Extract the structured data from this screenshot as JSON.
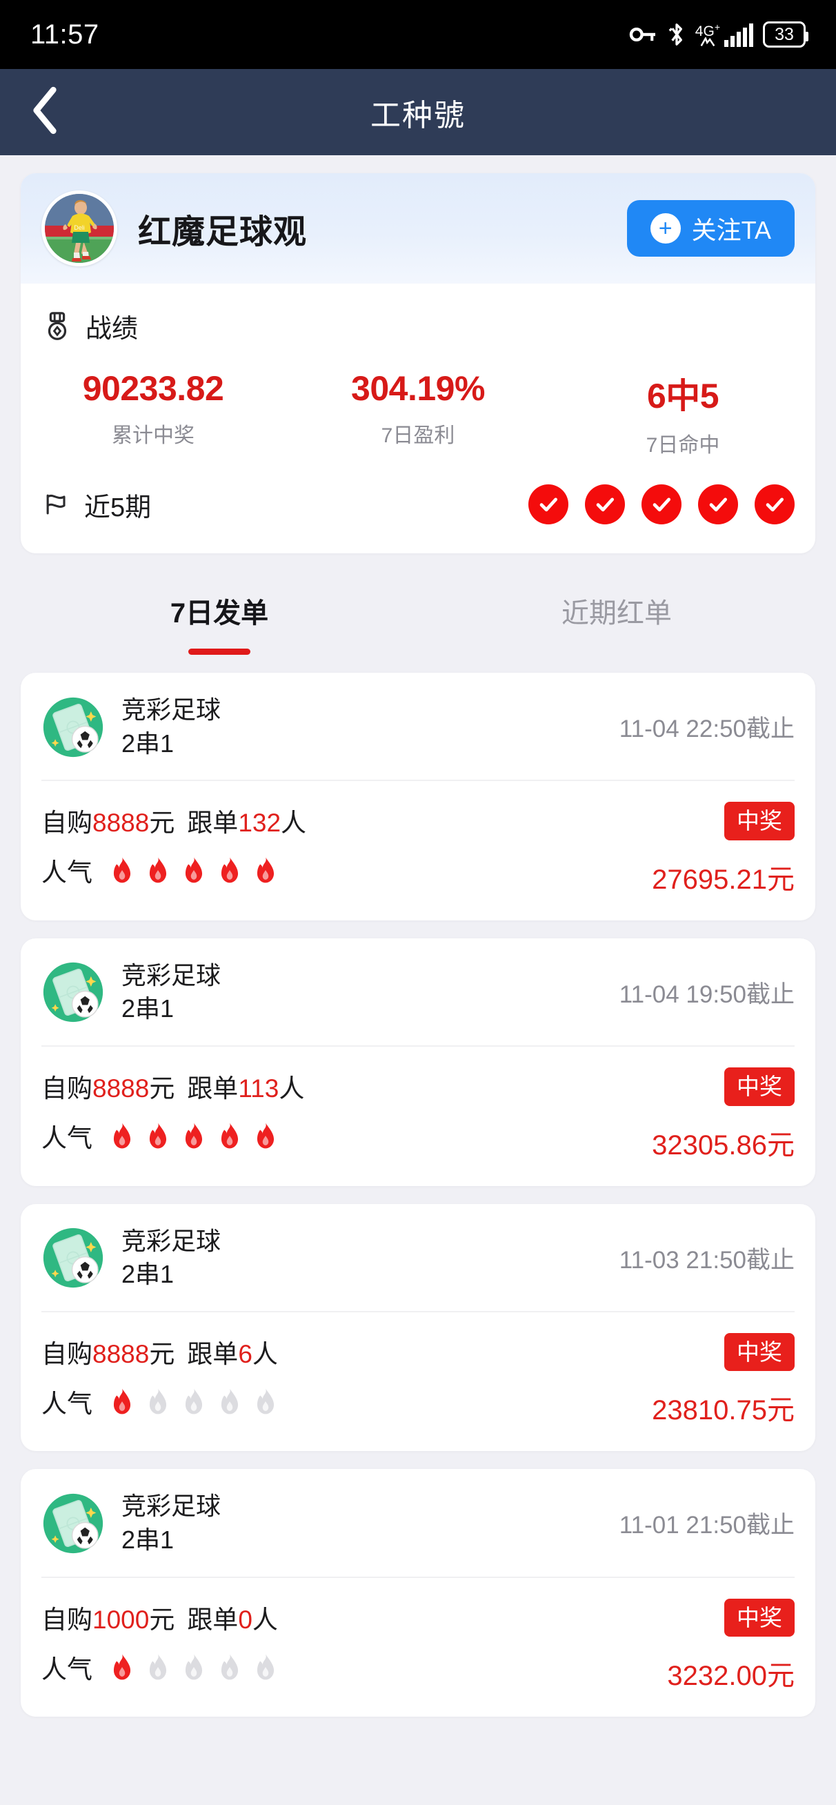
{
  "status_bar": {
    "time": "11:57",
    "battery_level": "33",
    "network_label": "4G",
    "network_plus": "+",
    "icons": [
      "vpn-key-icon",
      "bluetooth-icon",
      "signal-icon",
      "battery-icon"
    ]
  },
  "nav": {
    "title": "工种號",
    "back_icon": "chevron-left-icon"
  },
  "profile": {
    "username": "红魔足球观",
    "avatar_icon": "soccer-player-avatar",
    "follow_button": {
      "label": "关注TA",
      "plus_icon": "plus-icon",
      "color": "#2088f5"
    },
    "record": {
      "icon": "medal-icon",
      "label": "战绩",
      "stats": [
        {
          "value": "90233.82",
          "caption": "累计中奖"
        },
        {
          "value": "304.19%",
          "caption": "7日盈利"
        },
        {
          "value": "6中5",
          "caption": "7日命中"
        }
      ]
    },
    "recent": {
      "icon": "flag-icon",
      "label": "近5期",
      "results": [
        "win",
        "win",
        "win",
        "win",
        "win"
      ],
      "win_icon": "check-circle-icon",
      "win_color": "#f40c0c"
    }
  },
  "tabs": [
    {
      "label": "7日发单",
      "active": true
    },
    {
      "label": "近期红单",
      "active": false
    }
  ],
  "bets": [
    {
      "icon": "soccer-lottery-icon",
      "game": "竞彩足球",
      "combo": "2串1",
      "deadline": "11-04 22:50截止",
      "self_buy_prefix": "自购",
      "self_buy_amount": "8888",
      "self_buy_unit": "元",
      "follow_prefix": "跟单",
      "follow_count": "132",
      "follow_unit": "人",
      "popularity_label": "人气",
      "popularity": 5,
      "status_badge": "中奖",
      "prize": "27695.21元"
    },
    {
      "icon": "soccer-lottery-icon",
      "game": "竞彩足球",
      "combo": "2串1",
      "deadline": "11-04 19:50截止",
      "self_buy_prefix": "自购",
      "self_buy_amount": "8888",
      "self_buy_unit": "元",
      "follow_prefix": "跟单",
      "follow_count": "113",
      "follow_unit": "人",
      "popularity_label": "人气",
      "popularity": 5,
      "status_badge": "中奖",
      "prize": "32305.86元"
    },
    {
      "icon": "soccer-lottery-icon",
      "game": "竞彩足球",
      "combo": "2串1",
      "deadline": "11-03 21:50截止",
      "self_buy_prefix": "自购",
      "self_buy_amount": "8888",
      "self_buy_unit": "元",
      "follow_prefix": "跟单",
      "follow_count": "6",
      "follow_unit": "人",
      "popularity_label": "人气",
      "popularity": 1,
      "status_badge": "中奖",
      "prize": "23810.75元"
    },
    {
      "icon": "soccer-lottery-icon",
      "game": "竞彩足球",
      "combo": "2串1",
      "deadline": "11-01 21:50截止",
      "self_buy_prefix": "自购",
      "self_buy_amount": "1000",
      "self_buy_unit": "元",
      "follow_prefix": "跟单",
      "follow_count": "0",
      "follow_unit": "人",
      "popularity_label": "人气",
      "popularity": 1,
      "status_badge": "中奖",
      "prize": "3232.00元"
    }
  ],
  "colors": {
    "accent_red": "#e0201c",
    "accent_blue": "#2088f5",
    "navbar": "#2f3c57",
    "page_bg": "#f0f0f5",
    "flame_on": "#ee2020",
    "flame_off": "#dcdce0"
  }
}
